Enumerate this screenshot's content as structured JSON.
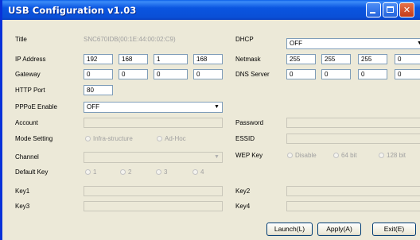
{
  "window": {
    "title": "USB Configuration v1.03"
  },
  "labels": {
    "title": "Title",
    "ip": "IP Address",
    "gateway": "Gateway",
    "http_port": "HTTP Port",
    "pppoe": "PPPoE Enable",
    "account": "Account",
    "mode": "Mode Setting",
    "channel": "Channel",
    "default_key": "Default Key",
    "key1": "Key1",
    "key3": "Key3",
    "dhcp": "DHCP",
    "netmask": "Netmask",
    "dns": "DNS Server",
    "password": "Password",
    "essid": "ESSID",
    "wep": "WEP Key",
    "key2": "Key2",
    "key4": "Key4"
  },
  "title_value": "SNC670IDB(00:1E:44:00:02:C9)",
  "ip": [
    "192",
    "168",
    "1",
    "168"
  ],
  "gateway": [
    "0",
    "0",
    "0",
    "0"
  ],
  "http_port": "80",
  "pppoe": "OFF",
  "dhcp": "OFF",
  "netmask": [
    "255",
    "255",
    "255",
    "0"
  ],
  "dns": [
    "0",
    "0",
    "0",
    "0"
  ],
  "mode_options": [
    "Infra-structure",
    "Ad-Hoc"
  ],
  "key_options": [
    "1",
    "2",
    "3",
    "4"
  ],
  "wep_options": [
    "Disable",
    "64 bit",
    "128 bit"
  ],
  "buttons": {
    "launch": "Launch(L)",
    "apply": "Apply(A)",
    "exit": "Exit(E)"
  }
}
